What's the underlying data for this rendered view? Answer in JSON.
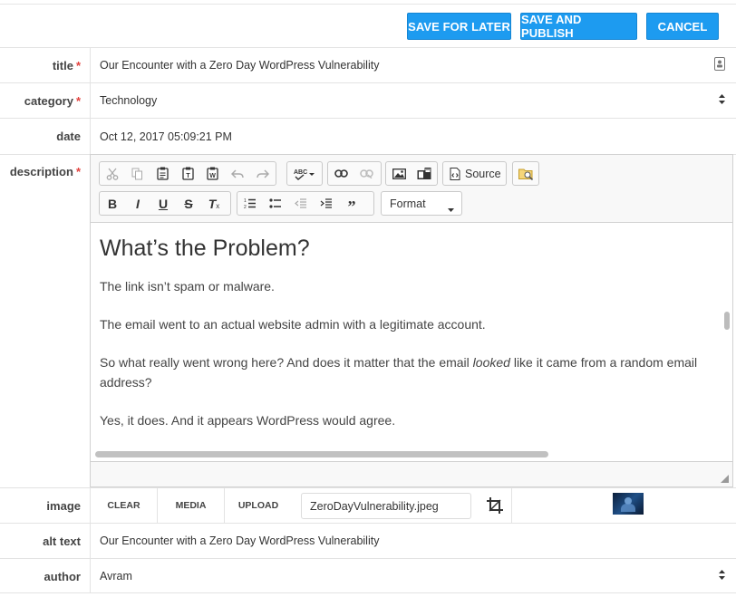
{
  "actions": {
    "save_later": "SAVE FOR LATER",
    "save_publish": "SAVE AND PUBLISH",
    "cancel": "CANCEL"
  },
  "fields": {
    "title": {
      "label": "title",
      "required": "*",
      "value": "Our Encounter with a Zero Day WordPress Vulnerability"
    },
    "category": {
      "label": "category",
      "required": "*",
      "value": "Technology"
    },
    "date": {
      "label": "date",
      "value": "Oct 12, 2017 05:09:21 PM"
    },
    "description": {
      "label": "description",
      "required": "*"
    },
    "image": {
      "label": "image",
      "clear": "CLEAR",
      "media": "MEDIA",
      "upload": "UPLOAD",
      "filename": "ZeroDayVulnerability.jpeg"
    },
    "alt_text": {
      "label": "alt text",
      "value": "Our Encounter with a Zero Day WordPress Vulnerability"
    },
    "author": {
      "label": "author",
      "value": "Avram"
    }
  },
  "editor": {
    "source_label": "Source",
    "format_label": "Format",
    "heading": "What’s the Problem?",
    "p1": "The link isn’t spam or malware.",
    "p2": "The email went to an actual website admin with a legitimate account.",
    "p3_before": "So what really went wrong here? And does it matter that the email ",
    "p3_em": "looked",
    "p3_after": " like it came from a random email address?",
    "p4": "Yes, it does. And it appears WordPress would agree."
  },
  "colors": {
    "primary_button": "#1d9bf0",
    "required": "#e2413d"
  }
}
